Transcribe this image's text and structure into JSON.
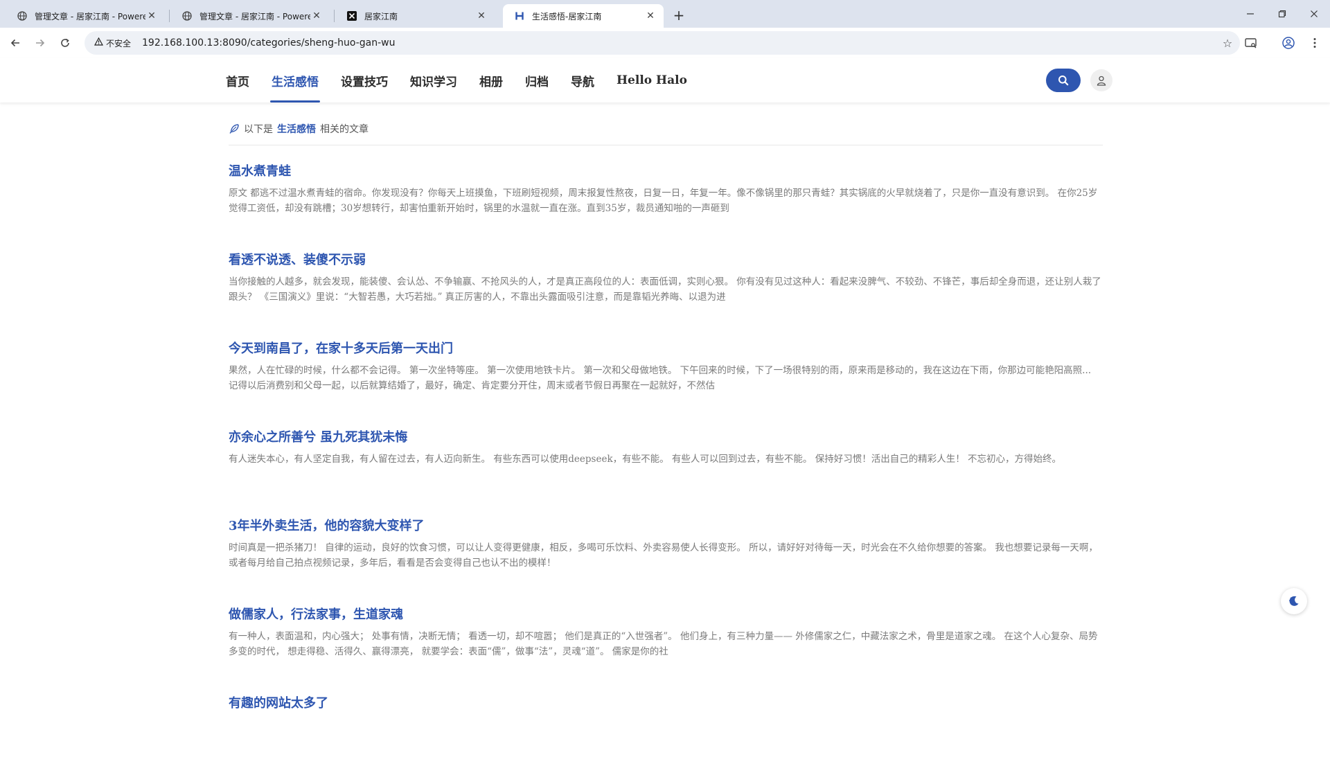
{
  "browser": {
    "tabs": [
      {
        "title": "管理文章 - 居家江南 - Powered by Halo",
        "favicon": "globe-icon",
        "active": false
      },
      {
        "title": "管理文章 - 居家江南 - Powered by Halo",
        "favicon": "globe-icon",
        "active": false
      },
      {
        "title": "居家江南",
        "favicon": "x-logo-icon",
        "active": false
      },
      {
        "title": "生活感悟-居家江南",
        "favicon": "h-logo-icon",
        "active": true
      }
    ],
    "security_label": "不安全",
    "url": "192.168.100.13:8090/categories/sheng-huo-gan-wu"
  },
  "site": {
    "nav": [
      {
        "label": "首页",
        "active": false
      },
      {
        "label": "生活感悟",
        "active": true
      },
      {
        "label": "设置技巧",
        "active": false
      },
      {
        "label": "知识学习",
        "active": false
      },
      {
        "label": "相册",
        "active": false
      },
      {
        "label": "归档",
        "active": false
      },
      {
        "label": "导航",
        "active": false
      },
      {
        "label": "Hello Halo",
        "active": false
      }
    ],
    "accent_color": "#2e56b0"
  },
  "category_banner": {
    "prefix": "以下是",
    "name": "生活感悟",
    "suffix": "相关的文章"
  },
  "posts": [
    {
      "title": "温水煮青蛙",
      "excerpt": "原文 都逃不过温水煮青蛙的宿命。你发现没有？你每天上班摸鱼，下班刷短视频，周末报复性熬夜，日复一日，年复一年。像不像锅里的那只青蛙？其实锅底的火早就烧着了，只是你一直没有意识到。 在你25岁觉得工资低，却没有跳槽；30岁想转行，却害怕重新开始时，锅里的水温就一直在涨。直到35岁，裁员通知啪的一声砸到"
    },
    {
      "title": "看透不说透、装傻不示弱",
      "excerpt": "当你接触的人越多，就会发现，能装傻、会认怂、不争输赢、不抢风头的人，才是真正高段位的人：表面低调，实则心狠。 你有没有见过这种人：看起来没脾气、不较劲、不锋芒，事后却全身而退，还让别人栽了跟头？ 《三国演义》里说：“大智若愚，大巧若拙。” 真正厉害的人，不靠出头露面吸引注意，而是靠韬光养晦、以退为进"
    },
    {
      "title": "今天到南昌了，在家十多天后第一天出门",
      "excerpt": "果然，人在忙碌的时候，什么都不会记得。 第一次坐特等座。 第一次使用地铁卡片。 第一次和父母做地铁。 下午回来的时候，下了一场很特别的雨，原来雨是移动的，我在这边在下雨，你那边可能艳阳高照... 记得以后消费别和父母一起，以后就算结婚了，最好，确定、肯定要分开住，周末或者节假日再聚在一起就好，不然估"
    },
    {
      "title": "亦余心之所善兮 虽九死其犹未悔",
      "excerpt": "有人迷失本心，有人坚定自我，有人留在过去，有人迈向新生。 有些东西可以使用deepseek，有些不能。 有些人可以回到过去，有些不能。 保持好习惯！活出自己的精彩人生！ 不忘初心，方得始终。"
    },
    {
      "title": "3年半外卖生活，他的容貌大变样了",
      "excerpt": "时间真是一把杀猪刀！ 自律的运动，良好的饮食习惯，可以让人变得更健康，相反，多喝可乐饮料、外卖容易使人长得变形。 所以，请好好对待每一天，时光会在不久给你想要的答案。 我也想要记录每一天啊，或者每月给自己拍点视频记录，多年后，看看是否会变得自己也认不出的模样！"
    },
    {
      "title": "做儒家人，行法家事，生道家魂",
      "excerpt": "有一种人，表面温和，内心强大； 处事有情，决断无情； 看透一切，却不喧嚣； 他们是真正的“入世强者”。 他们身上，有三种力量—— 外修儒家之仁，中藏法家之术，骨里是道家之魂。 在这个人心复杂、局势多变的时代， 想走得稳、活得久、赢得漂亮， 就要学会：表面“儒”，做事“法”，灵魂“道”。 儒家是你的社"
    },
    {
      "title": "有趣的网站太多了",
      "excerpt": ""
    }
  ]
}
